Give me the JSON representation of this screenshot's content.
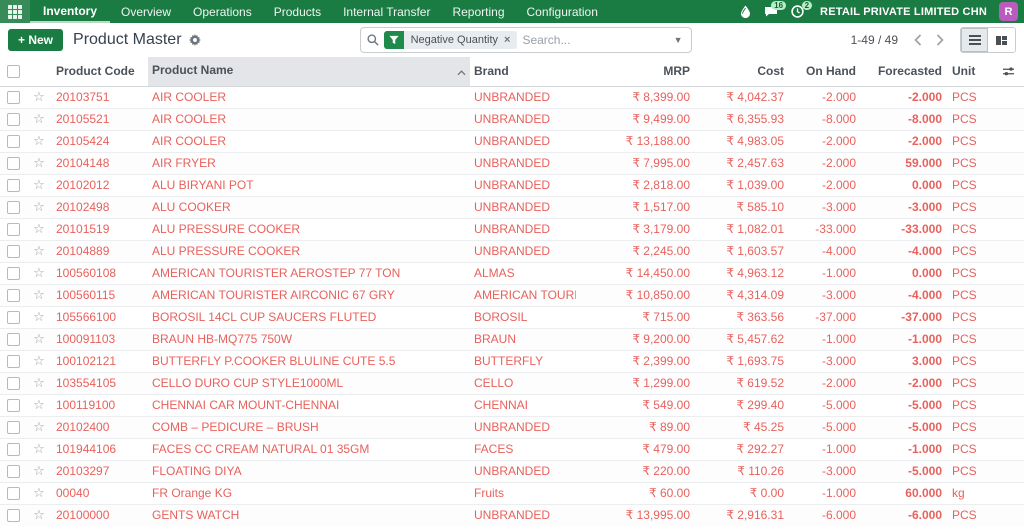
{
  "colors": {
    "brand_green": "#1b7c43",
    "row_danger_red": "#e8615c",
    "badge_green_bg": "#b7efc5",
    "avatar_purple": "#bb5bc0"
  },
  "navbar": {
    "app_name": "Inventory",
    "menus": [
      "Overview",
      "Operations",
      "Products",
      "Internal Transfer",
      "Reporting",
      "Configuration"
    ],
    "message_badge": "16",
    "activity_badge": "2",
    "company": "RETAIL PRIVATE LIMITED CHN",
    "avatar_initial": "R"
  },
  "control_panel": {
    "new_button": "New",
    "title": "Product Master",
    "search": {
      "facet": "Negative Quantity",
      "facet_close": "×",
      "placeholder": "Search..."
    },
    "pager": {
      "value": "1-49 / 49"
    }
  },
  "table": {
    "headers": [
      "Product Code",
      "Product Name",
      "Brand",
      "MRP",
      "Cost",
      "On Hand",
      "Forecasted",
      "Unit"
    ],
    "sorted_column": "Product Name",
    "sort_direction": "asc",
    "rows": [
      {
        "code": "20103751",
        "name": "AIR COOLER",
        "brand": "UNBRANDED",
        "mrp": "₹ 8,399.00",
        "cost": "₹ 4,042.37",
        "on_hand": "-2.000",
        "forecasted": "-2.000",
        "unit": "PCS"
      },
      {
        "code": "20105521",
        "name": "AIR COOLER",
        "brand": "UNBRANDED",
        "mrp": "₹ 9,499.00",
        "cost": "₹ 6,355.93",
        "on_hand": "-8.000",
        "forecasted": "-8.000",
        "unit": "PCS"
      },
      {
        "code": "20105424",
        "name": "AIR COOLER",
        "brand": "UNBRANDED",
        "mrp": "₹ 13,188.00",
        "cost": "₹ 4,983.05",
        "on_hand": "-2.000",
        "forecasted": "-2.000",
        "unit": "PCS"
      },
      {
        "code": "20104148",
        "name": "AIR FRYER",
        "brand": "UNBRANDED",
        "mrp": "₹ 7,995.00",
        "cost": "₹ 2,457.63",
        "on_hand": "-2.000",
        "forecasted": "59.000",
        "unit": "PCS"
      },
      {
        "code": "20102012",
        "name": "ALU BIRYANI POT",
        "brand": "UNBRANDED",
        "mrp": "₹ 2,818.00",
        "cost": "₹ 1,039.00",
        "on_hand": "-2.000",
        "forecasted": "0.000",
        "unit": "PCS"
      },
      {
        "code": "20102498",
        "name": "ALU COOKER",
        "brand": "UNBRANDED",
        "mrp": "₹ 1,517.00",
        "cost": "₹ 585.10",
        "on_hand": "-3.000",
        "forecasted": "-3.000",
        "unit": "PCS"
      },
      {
        "code": "20101519",
        "name": "ALU PRESSURE COOKER",
        "brand": "UNBRANDED",
        "mrp": "₹ 3,179.00",
        "cost": "₹ 1,082.01",
        "on_hand": "-33.000",
        "forecasted": "-33.000",
        "unit": "PCS"
      },
      {
        "code": "20104889",
        "name": "ALU PRESSURE COOKER",
        "brand": "UNBRANDED",
        "mrp": "₹ 2,245.00",
        "cost": "₹ 1,603.57",
        "on_hand": "-4.000",
        "forecasted": "-4.000",
        "unit": "PCS"
      },
      {
        "code": "100560108",
        "name": "AMERICAN TOURISTER AEROSTEP 77 TON",
        "brand": "ALMAS",
        "mrp": "₹ 14,450.00",
        "cost": "₹ 4,963.12",
        "on_hand": "-1.000",
        "forecasted": "0.000",
        "unit": "PCS"
      },
      {
        "code": "100560115",
        "name": "AMERICAN TOURISTER AIRCONIC 67 GRY",
        "brand": "AMERICAN TOURISTER",
        "mrp": "₹ 10,850.00",
        "cost": "₹ 4,314.09",
        "on_hand": "-3.000",
        "forecasted": "-4.000",
        "unit": "PCS"
      },
      {
        "code": "105566100",
        "name": "BOROSIL 14CL CUP SAUCERS FLUTED",
        "brand": "BOROSIL",
        "mrp": "₹ 715.00",
        "cost": "₹ 363.56",
        "on_hand": "-37.000",
        "forecasted": "-37.000",
        "unit": "PCS"
      },
      {
        "code": "100091103",
        "name": "BRAUN HB-MQ775 750W",
        "brand": "BRAUN",
        "mrp": "₹ 9,200.00",
        "cost": "₹ 5,457.62",
        "on_hand": "-1.000",
        "forecasted": "-1.000",
        "unit": "PCS"
      },
      {
        "code": "100102121",
        "name": "BUTTERFLY P.COOKER BLULINE CUTE 5.5",
        "brand": "BUTTERFLY",
        "mrp": "₹ 2,399.00",
        "cost": "₹ 1,693.75",
        "on_hand": "-3.000",
        "forecasted": "3.000",
        "unit": "PCS"
      },
      {
        "code": "103554105",
        "name": "CELLO DURO CUP STYLE1000ML",
        "brand": "CELLO",
        "mrp": "₹ 1,299.00",
        "cost": "₹ 619.52",
        "on_hand": "-2.000",
        "forecasted": "-2.000",
        "unit": "PCS"
      },
      {
        "code": "100119100",
        "name": "CHENNAI CAR MOUNT-CHENNAI",
        "brand": "CHENNAI",
        "mrp": "₹ 549.00",
        "cost": "₹ 299.40",
        "on_hand": "-5.000",
        "forecasted": "-5.000",
        "unit": "PCS"
      },
      {
        "code": "20102400",
        "name": "COMB – PEDICURE – BRUSH",
        "brand": "UNBRANDED",
        "mrp": "₹ 89.00",
        "cost": "₹ 45.25",
        "on_hand": "-5.000",
        "forecasted": "-5.000",
        "unit": "PCS"
      },
      {
        "code": "101944106",
        "name": "FACES CC CREAM NATURAL 01 35GM",
        "brand": "FACES",
        "mrp": "₹ 479.00",
        "cost": "₹ 292.27",
        "on_hand": "-1.000",
        "forecasted": "-1.000",
        "unit": "PCS"
      },
      {
        "code": "20103297",
        "name": "FLOATING DIYA",
        "brand": "UNBRANDED",
        "mrp": "₹ 220.00",
        "cost": "₹ 110.26",
        "on_hand": "-3.000",
        "forecasted": "-5.000",
        "unit": "PCS"
      },
      {
        "code": "00040",
        "name": "FR Orange KG",
        "brand": "Fruits",
        "mrp": "₹ 60.00",
        "cost": "₹ 0.00",
        "on_hand": "-1.000",
        "forecasted": "60.000",
        "unit": "kg"
      },
      {
        "code": "20100000",
        "name": "GENTS WATCH",
        "brand": "UNBRANDED",
        "mrp": "₹ 13,995.00",
        "cost": "₹ 2,916.31",
        "on_hand": "-6.000",
        "forecasted": "-6.000",
        "unit": "PCS"
      }
    ]
  }
}
